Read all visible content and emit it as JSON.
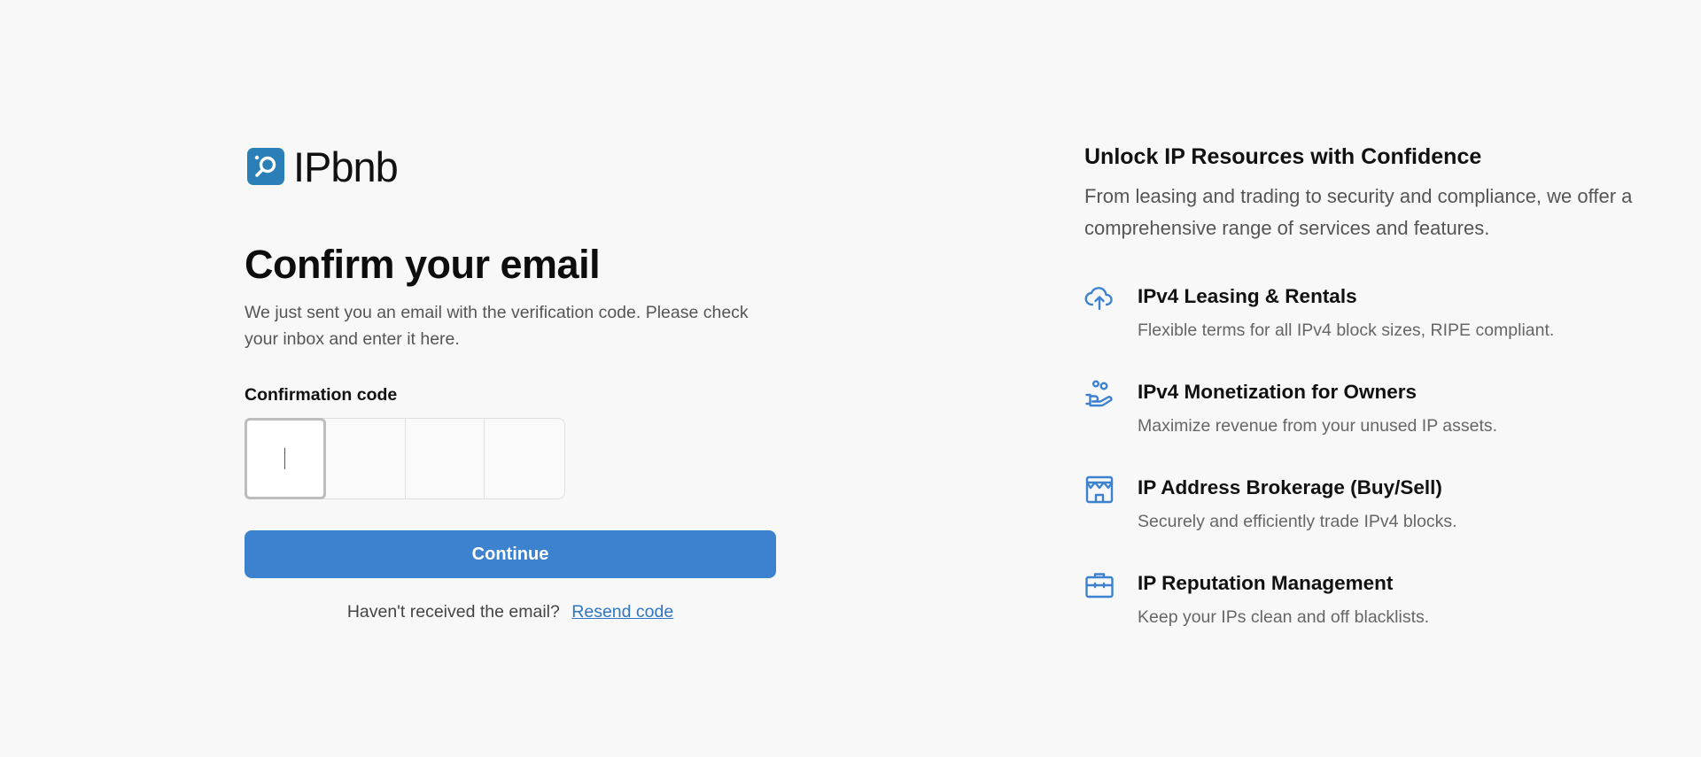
{
  "brand": {
    "name": "IPbnb",
    "color": "#2a7fb8"
  },
  "form": {
    "title": "Confirm your email",
    "subtitle": "We just sent you an email with the verification code. Please check your inbox and enter it here.",
    "code_label": "Confirmation code",
    "code_digits": [
      "",
      "",
      "",
      ""
    ],
    "continue_label": "Continue",
    "resend_prompt": "Haven't received the email?",
    "resend_link": "Resend code"
  },
  "promo": {
    "heading": "Unlock IP Resources with Confidence",
    "description": "From leasing and trading to security and compliance, we offer a comprehensive range of services and features.",
    "features": [
      {
        "icon": "cloud-upload-icon",
        "title": "IPv4 Leasing & Rentals",
        "description": "Flexible terms for all IPv4 block sizes, RIPE compliant."
      },
      {
        "icon": "hand-coins-icon",
        "title": "IPv4 Monetization for Owners",
        "description": "Maximize revenue from your unused IP assets."
      },
      {
        "icon": "store-icon",
        "title": "IP Address Brokerage (Buy/Sell)",
        "description": "Securely and efficiently trade IPv4 blocks."
      },
      {
        "icon": "briefcase-icon",
        "title": "IP Reputation Management",
        "description": "Keep your IPs clean and off blacklists."
      }
    ]
  },
  "colors": {
    "accent": "#3d82cf",
    "link": "#2f76c4",
    "icon": "#3d82cf",
    "background": "#f8f8f9"
  }
}
